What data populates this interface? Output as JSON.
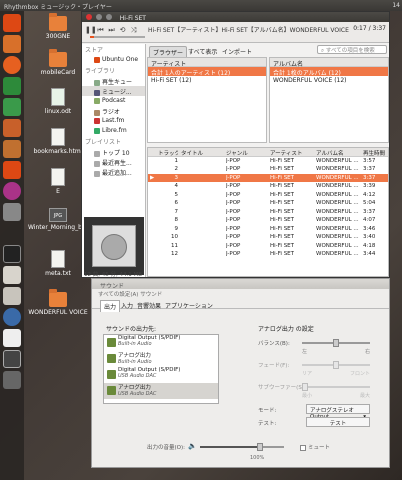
{
  "top_panel": {
    "title": "Rhythmbox ミュージック・プレイヤー",
    "clock": "14"
  },
  "desktop_icons": [
    {
      "label": "300GNE",
      "kind": "folder"
    },
    {
      "label": "mobileCard",
      "kind": "folder"
    },
    {
      "label": "linux.odt",
      "kind": "file"
    },
    {
      "label": "bookmarks.html",
      "kind": "file"
    },
    {
      "label": "E",
      "kind": "file"
    },
    {
      "label": "Winter_Morning_by_Shannon_Lucas.jpg",
      "kind": "image"
    },
    {
      "label": "meta.txt",
      "kind": "file"
    },
    {
      "label": "WONDERFUL VOICE",
      "kind": "folder"
    }
  ],
  "rhythmbox": {
    "title": "Hi-Fi SET",
    "now_playing": "Hi-Fi SET【アーティスト】Hi-Fi SET【アルバム名】WONDERFUL VOICE",
    "time": "0:17 / 3:37",
    "progress": 0.08,
    "browse_tabs": [
      "ブラウザー",
      "すべて表示",
      "インポート"
    ],
    "search_placeholder": "すべての項目を検索",
    "sidebar": {
      "store_header": "ストア",
      "store_items": [
        "Ubuntu One"
      ],
      "library_header": "ライブラリ",
      "library_items": [
        "再生キュー",
        "ミュージ...",
        "Podcast",
        "ラジオ",
        "Last.fm",
        "Libre.fm"
      ],
      "playlist_header": "プレイリスト",
      "playlist_items": [
        "トップ 10",
        "最近再生...",
        "最近追加..."
      ]
    },
    "status": "12 曲, 45 分, 44.1 MB",
    "artist_browser": {
      "header": "アーティスト",
      "rows": [
        "合計 1人のアーティスト (12)",
        "Hi-Fi SET (12)"
      ],
      "selected": 0
    },
    "album_browser": {
      "header": "アルバム名",
      "rows": [
        "合計 1枚のアルバム (12)",
        "WONDERFUL VOICE (12)"
      ],
      "selected": 0
    },
    "track_columns": [
      "トラック",
      "タイトル",
      "ジャンル",
      "アーティスト",
      "アルバム名",
      "再生時間"
    ],
    "tracks": [
      {
        "n": "1",
        "genre": "J-POP",
        "artist": "Hi-Fi SET",
        "album": "WONDERFUL ...",
        "time": "3:57",
        "tw": 22
      },
      {
        "n": "2",
        "genre": "J-POP",
        "artist": "Hi-Fi SET",
        "album": "WONDERFUL ...",
        "time": "3:37",
        "tw": 26
      },
      {
        "n": "3",
        "genre": "J-POP",
        "artist": "Hi-Fi SET",
        "album": "WONDERFUL ...",
        "time": "3:37",
        "tw": 24,
        "playing": true
      },
      {
        "n": "4",
        "genre": "J-POP",
        "artist": "Hi-Fi SET",
        "album": "WONDERFUL ...",
        "time": "3:39",
        "tw": 28
      },
      {
        "n": "5",
        "genre": "J-POP",
        "artist": "Hi-Fi SET",
        "album": "WONDERFUL ...",
        "time": "4:12",
        "tw": 20
      },
      {
        "n": "6",
        "genre": "J-POP",
        "artist": "Hi-Fi SET",
        "album": "WONDERFUL ...",
        "time": "5:04",
        "tw": 30
      },
      {
        "n": "7",
        "genre": "J-POP",
        "artist": "Hi-Fi SET",
        "album": "WONDERFUL ...",
        "time": "3:37",
        "tw": 24
      },
      {
        "n": "8",
        "genre": "J-POP",
        "artist": "Hi-Fi SET",
        "album": "WONDERFUL ...",
        "time": "4:07",
        "tw": 18
      },
      {
        "n": "9",
        "genre": "J-POP",
        "artist": "Hi-Fi SET",
        "album": "WONDERFUL ...",
        "time": "3:46",
        "tw": 26
      },
      {
        "n": "10",
        "genre": "J-POP",
        "artist": "Hi-Fi SET",
        "album": "WONDERFUL ...",
        "time": "3:40",
        "tw": 22
      },
      {
        "n": "11",
        "genre": "J-POP",
        "artist": "Hi-Fi SET",
        "album": "WONDERFUL ...",
        "time": "4:18",
        "tw": 30
      },
      {
        "n": "12",
        "genre": "J-POP",
        "artist": "Hi-Fi SET",
        "album": "WONDERFUL ...",
        "time": "3:44",
        "tw": 24
      }
    ]
  },
  "sound": {
    "title": "サウンド",
    "breadcrumb": "すべての設定(A)  サウンド",
    "tabs": [
      "出力",
      "入力",
      "音響効果",
      "アプリケーション"
    ],
    "left_label": "サウンドの出力先:",
    "devices": [
      {
        "name": "Digital Output (S/PDIF)",
        "sub": "Built-in Audio"
      },
      {
        "name": "アナログ出力",
        "sub": "Built-in Audio"
      },
      {
        "name": "Digital Output (S/PDIF)",
        "sub": "USB Audio DAC"
      },
      {
        "name": "アナログ出力",
        "sub": "USB Audio DAC",
        "selected": true
      }
    ],
    "right_label": "アナログ出力 の設定",
    "balance_label": "バランス(B):",
    "balance_left": "左",
    "balance_right": "右",
    "balance_value": 0.5,
    "fade_label": "フェード(F):",
    "fade_left": "リア",
    "fade_right": "フロント",
    "fade_value": 0.5,
    "sub_label": "サブウーファー(S):",
    "sub_left": "最小",
    "sub_right": "最大",
    "sub_value": 0.0,
    "mode_label": "モード:",
    "mode_value": "アナログステレオ Output",
    "test_label": "テスト:",
    "test_button": "テスト",
    "volume_label": "出力の音量(O):",
    "volume_pct": "100%",
    "volume_value": 1.0,
    "mute_label": "ミュート"
  }
}
